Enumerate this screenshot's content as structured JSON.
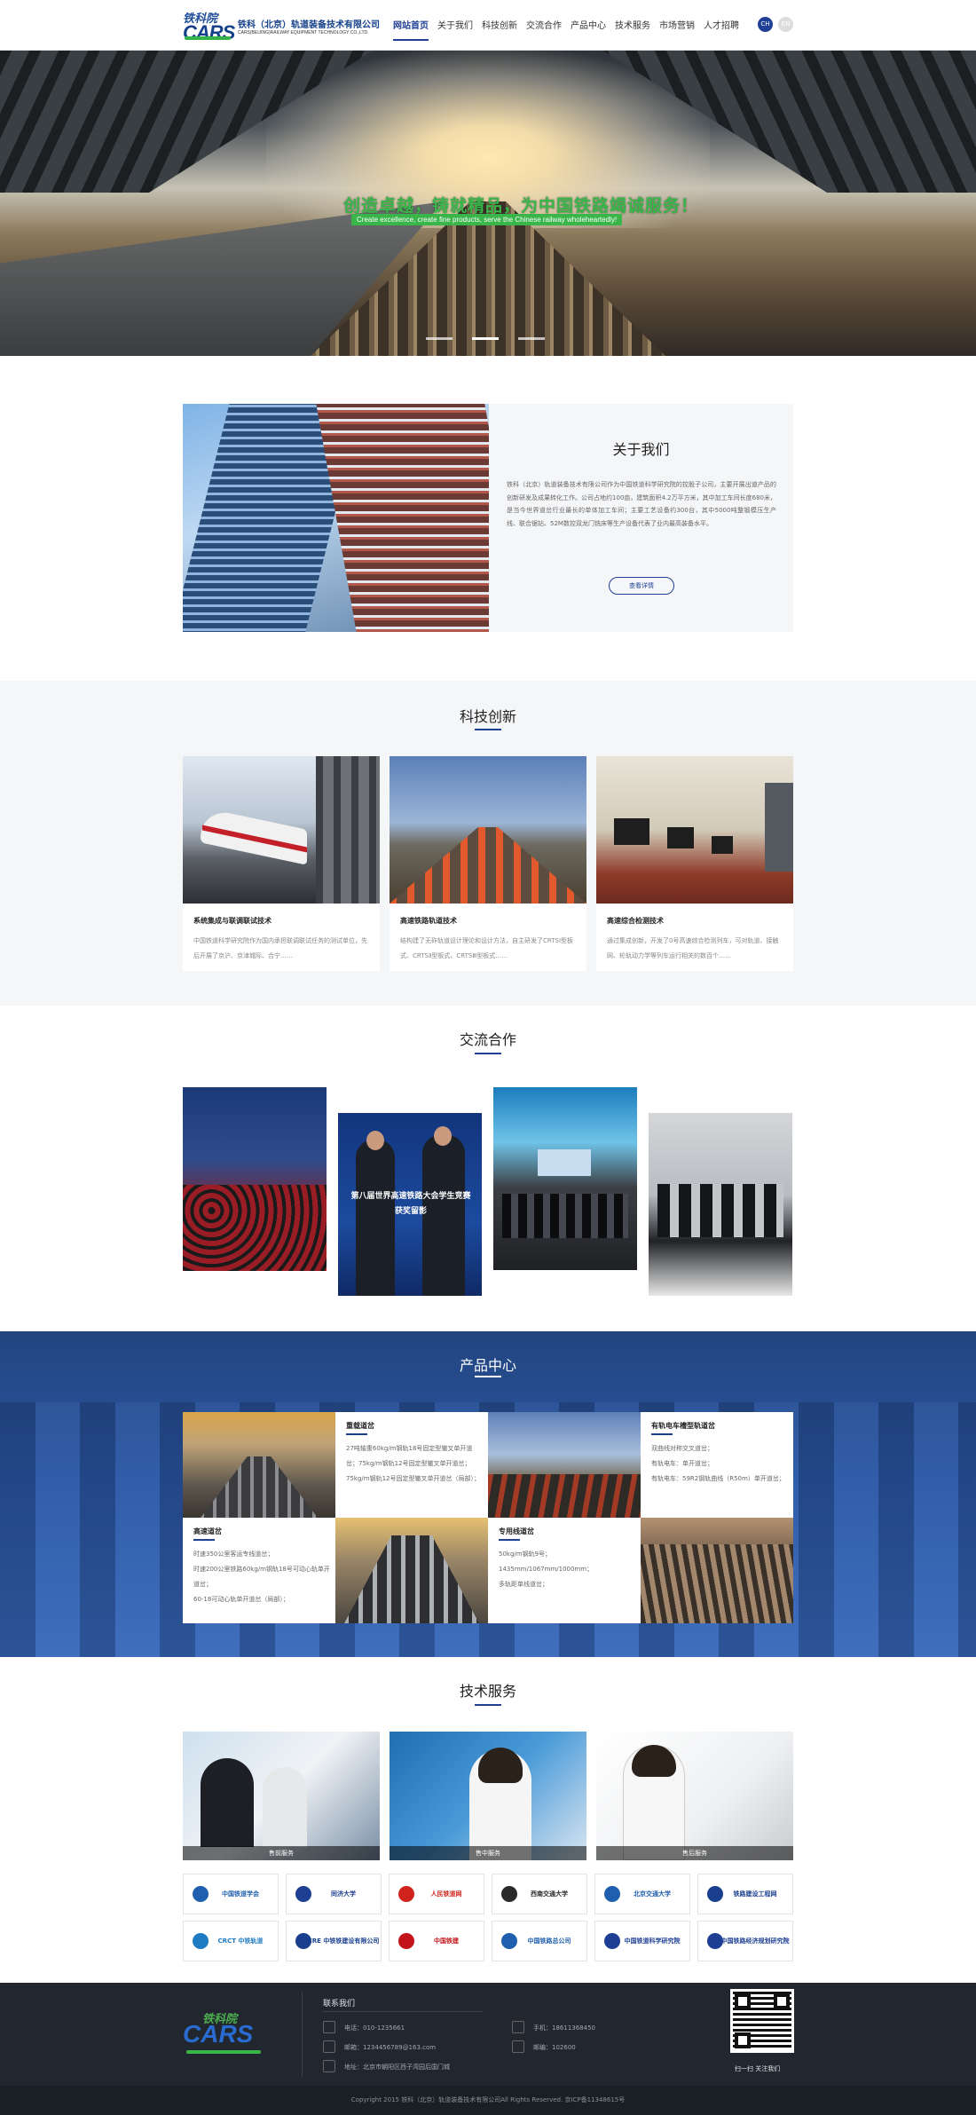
{
  "header": {
    "logo": {
      "cn": "铁科院",
      "en": "CARS",
      "name": "铁科（北京）轨道装备技术有限公司",
      "en_name": "CARS(BEIJING)RAILWAY EQUIPMENT TECHNOLOGY CO.,LTD."
    },
    "nav": [
      "网站首页",
      "关于我们",
      "科技创新",
      "交流合作",
      "产品中心",
      "技术服务",
      "市场营销",
      "人才招聘"
    ],
    "active": "网站首页",
    "lang": [
      "CH",
      "EN"
    ]
  },
  "hero": {
    "slogan": "创造卓越，铸就精品，为中国铁路竭诚服务！",
    "subtitle": "Create excellence, create fine products, serve the Chinese railway wholeheartedly!"
  },
  "about": {
    "title": "关于我们",
    "text": "铁科（北京）轨道装备技术有限公司作为中国铁道科学研究院的控股子公司，主要开展出道产品的创新研发及成果转化工作。公司占地约100亩，建筑面积4.2万平方米，其中加工车间长度680米，是当今世界道岔行业最长的单体加工车间；主要工艺设备约300台，其中5000吨整锻模压生产线、联合锯钻、52M数控双龙门铣床等生产设备代表了业内最高装备水平。",
    "more": "查看详情"
  },
  "tech": {
    "title": "科技创新",
    "cards": [
      {
        "title": "系统集成与联调联试技术",
        "desc": "中国铁道科学研究院作为国内承担联调联试任务的测试单位，先后开展了京沪、京津城际、合宁……"
      },
      {
        "title": "高速铁路轨道技术",
        "desc": "结构建了无砟轨道设计理论和设计方法，自主研发了CRTSⅠ型板式、CRTSⅡ型板式、CRTSⅢ型板式……"
      },
      {
        "title": "高速综合检测技术",
        "desc": "通过集成创新，开发了0号高速综合检测列车，可对轨道、接触网、轮轨动力学等列车运行相关的数百个……"
      }
    ]
  },
  "exchange": {
    "title": "交流合作",
    "banner": "第八届世界高速铁路大会学生竞赛获奖留影"
  },
  "product": {
    "title": "产品中心",
    "items": [
      {
        "title": "重载道岔",
        "lines": [
          "27吨轴重60kg/m钢轨18号固定型辙叉单开道岔；75kg/m钢轨12号固定型辙叉单开道岔；75kg/m钢轨12号固定型辙叉单开道岔（局部）；"
        ]
      },
      {
        "title": "有轨电车槽型轨道岔",
        "lines": [
          "双曲线对称交叉道岔；",
          "有轨电车：单开道岔；",
          "有轨电车：59R2钢轨曲线（R50m）单开道岔；"
        ]
      },
      {
        "title": "高速道岔",
        "lines": [
          "时速350公里客运专线道岔；",
          "时速200公里铁路60kg/m钢轨18号可动心轨单开道岔；",
          "60-18可动心轨单开道岔（局部）；"
        ]
      },
      {
        "title": "专用线道岔",
        "lines": [
          "50kg/m钢轨9号；",
          "1435mm/1067mm/1000mm；",
          "多轨距单线道岔；"
        ]
      }
    ]
  },
  "service": {
    "title": "技术服务",
    "cards": [
      "售前服务",
      "售中服务",
      "售后服务"
    ],
    "partners": [
      "中国铁道学会",
      "同济大学",
      "人民铁道网",
      "西南交通大学",
      "北京交通大学",
      "铁路建设工程网",
      "CRCT 中铁轨道",
      "CRE 中铁铁建设有限公司",
      "中国铁建",
      "中国铁路总公司",
      "中国铁道科学研究院",
      "中国铁路经济规划研究院"
    ],
    "partner_colors": [
      "#1f5fae",
      "#1e3f93",
      "#d0231c",
      "#2a2a2a",
      "#1f5fae",
      "#1a3f8f",
      "#1f7bc1",
      "#1a3f8f",
      "#c3141a",
      "#1f5fae",
      "#1e3f93",
      "#1e3f93"
    ]
  },
  "footer": {
    "heading": "联系我们",
    "phone": "电话：010-1235661",
    "mobile": "手机：18611368450",
    "email": "邮箱：1234456789@163.com",
    "zip": "邮编：102600",
    "address": "地址：北京市朝阳区西子湾园后国门城",
    "qr_caption": "扫一扫  关注我们",
    "copyright": "Copyright 2015 铁科（北京）轨道装备技术有限公司All Rights Reserved. 京ICP备11348615号"
  },
  "colors": {
    "brand": "#1e3f93",
    "accent_green": "#39b54a",
    "footer_bg": "#22272f"
  }
}
